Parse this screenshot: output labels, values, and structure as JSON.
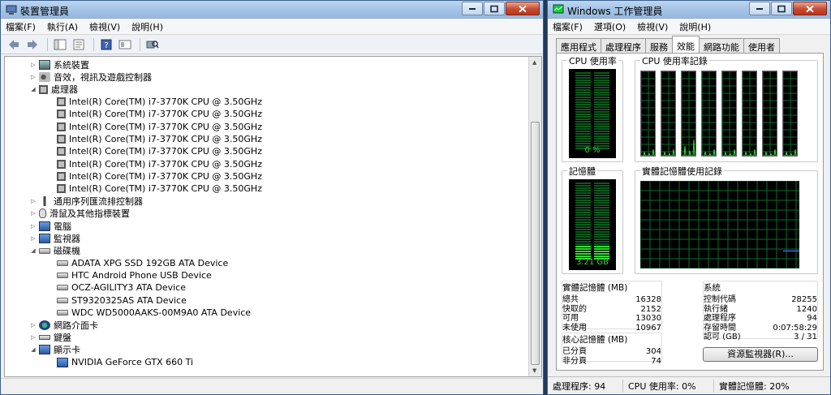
{
  "device_manager": {
    "title": "裝置管理員",
    "menu": [
      "檔案(F)",
      "執行(A)",
      "檢視(V)",
      "說明(H)"
    ],
    "tree": [
      {
        "label": "系統裝置",
        "level": 0,
        "state": "collapsed",
        "icon": "system-icon"
      },
      {
        "label": "音效，視訊及遊戲控制器",
        "level": 0,
        "state": "collapsed",
        "icon": "speaker-icon"
      },
      {
        "label": "處理器",
        "level": 0,
        "state": "expanded",
        "icon": "processor-icon"
      },
      {
        "label": "Intel(R) Core(TM) i7-3770K CPU @ 3.50GHz",
        "level": 1,
        "state": "leaf",
        "icon": "processor-icon"
      },
      {
        "label": "Intel(R) Core(TM) i7-3770K CPU @ 3.50GHz",
        "level": 1,
        "state": "leaf",
        "icon": "processor-icon"
      },
      {
        "label": "Intel(R) Core(TM) i7-3770K CPU @ 3.50GHz",
        "level": 1,
        "state": "leaf",
        "icon": "processor-icon"
      },
      {
        "label": "Intel(R) Core(TM) i7-3770K CPU @ 3.50GHz",
        "level": 1,
        "state": "leaf",
        "icon": "processor-icon"
      },
      {
        "label": "Intel(R) Core(TM) i7-3770K CPU @ 3.50GHz",
        "level": 1,
        "state": "leaf",
        "icon": "processor-icon"
      },
      {
        "label": "Intel(R) Core(TM) i7-3770K CPU @ 3.50GHz",
        "level": 1,
        "state": "leaf",
        "icon": "processor-icon"
      },
      {
        "label": "Intel(R) Core(TM) i7-3770K CPU @ 3.50GHz",
        "level": 1,
        "state": "leaf",
        "icon": "processor-icon"
      },
      {
        "label": "Intel(R) Core(TM) i7-3770K CPU @ 3.50GHz",
        "level": 1,
        "state": "leaf",
        "icon": "processor-icon"
      },
      {
        "label": "通用序列匯流排控制器",
        "level": 0,
        "state": "collapsed",
        "icon": "usb-icon"
      },
      {
        "label": "滑鼠及其他指標裝置",
        "level": 0,
        "state": "collapsed",
        "icon": "mouse-icon"
      },
      {
        "label": "電腦",
        "level": 0,
        "state": "collapsed",
        "icon": "computer-icon"
      },
      {
        "label": "監視器",
        "level": 0,
        "state": "collapsed",
        "icon": "monitor-icon"
      },
      {
        "label": "磁碟機",
        "level": 0,
        "state": "expanded",
        "icon": "disk-icon"
      },
      {
        "label": "ADATA  XPG SSD 192GB ATA Device",
        "level": 1,
        "state": "leaf",
        "icon": "disk-icon"
      },
      {
        "label": "HTC Android Phone USB Device",
        "level": 1,
        "state": "leaf",
        "icon": "disk-icon"
      },
      {
        "label": "OCZ-AGILITY3 ATA Device",
        "level": 1,
        "state": "leaf",
        "icon": "disk-icon"
      },
      {
        "label": "ST9320325AS ATA Device",
        "level": 1,
        "state": "leaf",
        "icon": "disk-icon"
      },
      {
        "label": "WDC WD5000AAKS-00M9A0 ATA Device",
        "level": 1,
        "state": "leaf",
        "icon": "disk-icon"
      },
      {
        "label": "網路介面卡",
        "level": 0,
        "state": "collapsed",
        "icon": "network-icon"
      },
      {
        "label": "鍵盤",
        "level": 0,
        "state": "collapsed",
        "icon": "keyboard-icon"
      },
      {
        "label": "顯示卡",
        "level": 0,
        "state": "expanded",
        "icon": "display-icon"
      },
      {
        "label": "NVIDIA GeForce GTX 660 Ti",
        "level": 1,
        "state": "leaf",
        "icon": "display-icon"
      }
    ]
  },
  "task_manager": {
    "title": "Windows 工作管理員",
    "menu": [
      "檔案(F)",
      "選項(O)",
      "檢視(V)",
      "說明(H)"
    ],
    "tabs": [
      "應用程式",
      "處理程序",
      "服務",
      "效能",
      "網路功能",
      "使用者"
    ],
    "active_tab": 3,
    "cpu_usage": {
      "label": "CPU 使用率",
      "value": "0 %",
      "percent": 0
    },
    "cpu_history": {
      "label": "CPU 使用率記錄",
      "cores": 8
    },
    "memory": {
      "label": "記憶體",
      "value": "3.21 GB",
      "percent": 20
    },
    "memory_history": {
      "label": "實體記憶體使用記錄"
    },
    "physical_memory": {
      "title": "實體記憶體 (MB)",
      "rows": [
        {
          "k": "總共",
          "v": "16328"
        },
        {
          "k": "快取的",
          "v": "2152"
        },
        {
          "k": "可用",
          "v": "13030"
        },
        {
          "k": "未使用",
          "v": "10967"
        }
      ]
    },
    "kernel_memory": {
      "title": "核心記憶體 (MB)",
      "rows": [
        {
          "k": "已分頁",
          "v": "304"
        },
        {
          "k": "非分頁",
          "v": "74"
        }
      ]
    },
    "system": {
      "title": "系統",
      "rows": [
        {
          "k": "控制代碼",
          "v": "28255"
        },
        {
          "k": "執行緒",
          "v": "1240"
        },
        {
          "k": "處理程序",
          "v": "94"
        },
        {
          "k": "存留時間",
          "v": "0:07:58:29"
        },
        {
          "k": "認可 (GB)",
          "v": "3 / 31"
        }
      ]
    },
    "resource_monitor_button": "資源監視器(R)...",
    "status": {
      "processes": "處理程序: 94",
      "cpu": "CPU 使用率: 0%",
      "memory": "實體記憶體: 20%"
    },
    "colors": {
      "graph_green": "#2fdc2f",
      "grid": "#0b6b2b",
      "memory_line": "#3a6bd9"
    }
  }
}
